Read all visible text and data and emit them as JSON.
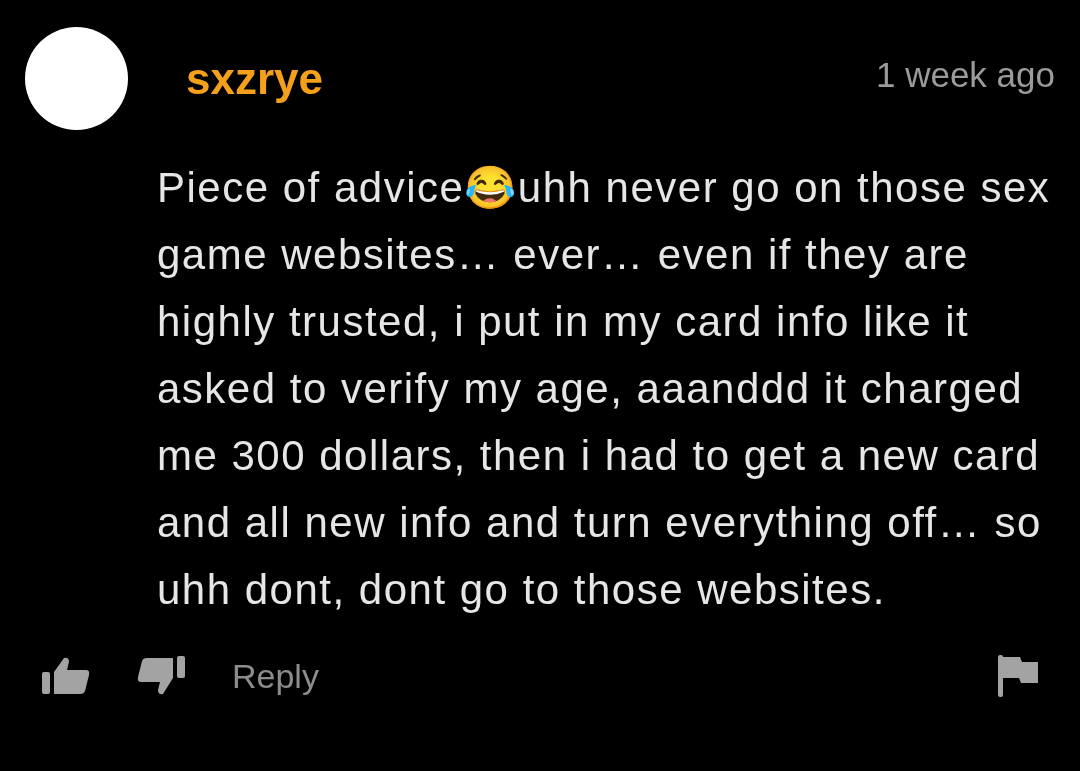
{
  "comment": {
    "author": "sxzrye",
    "time": "1 week ago",
    "body": "Piece of advice😂uhh never go on those sex game websites… ever… even if they are highly trusted, i put in my card info like it asked to verify my age, aaanddd it charged me 300 dollars, then i had to get a new card and all new info and turn everything off… so uhh dont, dont go to those websites.",
    "reply_label": "Reply"
  }
}
